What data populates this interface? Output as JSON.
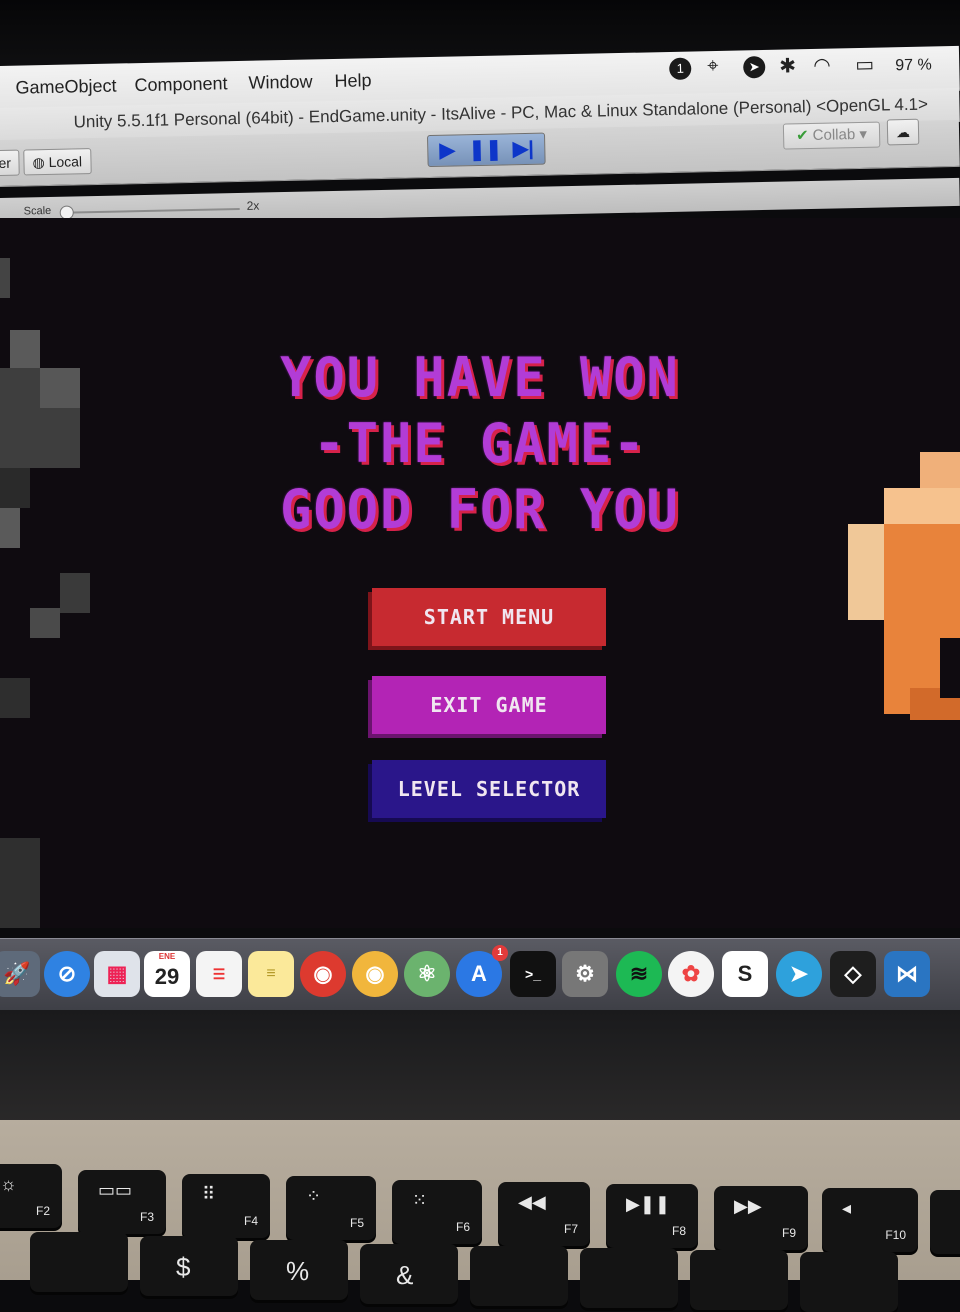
{
  "menubar": {
    "items": [
      "GameObject",
      "Component",
      "Window",
      "Help"
    ],
    "battery": "97 %"
  },
  "window": {
    "title": "Unity 5.5.1f1 Personal (64bit) - EndGame.unity - ItsAlive - PC, Mac & Linux Standalone (Personal) <OpenGL 4.1>"
  },
  "toolbar": {
    "pivot_partial": "er",
    "local_label": "Local",
    "collab_label": "Collab",
    "play_icon": "play-icon",
    "pause_icon": "pause-icon",
    "step_icon": "step-icon"
  },
  "gameview": {
    "scale_label": "Scale",
    "zoom_value": "2x"
  },
  "game": {
    "headline": [
      "YOU HAVE WON",
      "-THE GAME-",
      "GOOD FOR YOU"
    ],
    "buttons": {
      "start": "START MENU",
      "exit": "EXIT GAME",
      "level": "LEVEL SELECTOR"
    },
    "colors": {
      "start": "#c72a30",
      "exit": "#b324b5",
      "level": "#2a168a",
      "title": "#b23cd6"
    }
  },
  "dock": {
    "calendar_month": "ENE",
    "calendar_day": "29",
    "appstore_badge": "1",
    "apps": [
      "launchpad-icon",
      "safari-icon",
      "launchpad-grid-icon",
      "calendar-icon",
      "reminders-icon",
      "notes-icon",
      "chrome-icon",
      "chrome-canary-icon",
      "atom-icon",
      "app-store-icon",
      "terminal-icon",
      "system-preferences-icon",
      "spotify-icon",
      "photos-icon",
      "slack-icon",
      "telegram-icon",
      "unity-icon",
      "vscode-icon"
    ]
  },
  "keyboard": {
    "fkeys": [
      "F2",
      "F3",
      "F4",
      "F5",
      "F6",
      "F7",
      "F8",
      "F9",
      "F10"
    ],
    "symbols": [
      "$",
      "%",
      "&"
    ]
  }
}
